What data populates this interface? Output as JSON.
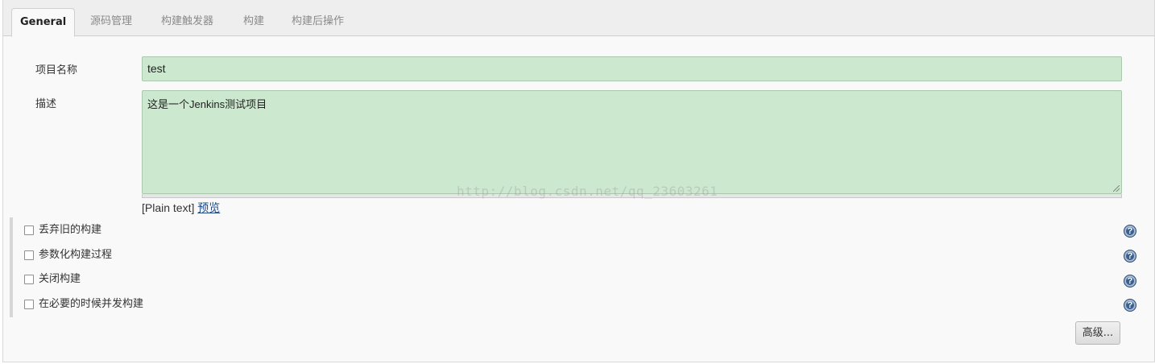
{
  "tabs": [
    {
      "label": "General",
      "active": true
    },
    {
      "label": "源码管理",
      "active": false
    },
    {
      "label": "构建触发器",
      "active": false
    },
    {
      "label": "构建",
      "active": false
    },
    {
      "label": "构建后操作",
      "active": false
    }
  ],
  "project_name": {
    "label": "项目名称",
    "value": "test"
  },
  "description": {
    "label": "描述",
    "value": "这是一个Jenkins测试项目",
    "format_text": "[Plain text]",
    "preview_link": "预览"
  },
  "watermark": "http://blog.csdn.net/qq_23603261",
  "options": [
    {
      "label": "丢弃旧的构建",
      "checked": false
    },
    {
      "label": "参数化构建过程",
      "checked": false
    },
    {
      "label": "关闭构建",
      "checked": false
    },
    {
      "label": "在必要的时候并发构建",
      "checked": false
    }
  ],
  "help_icon_glyph": "?",
  "advanced_button": "高级...",
  "colors": {
    "field_bg": "#cce8cf",
    "help_icon": "#3b5f8f"
  }
}
